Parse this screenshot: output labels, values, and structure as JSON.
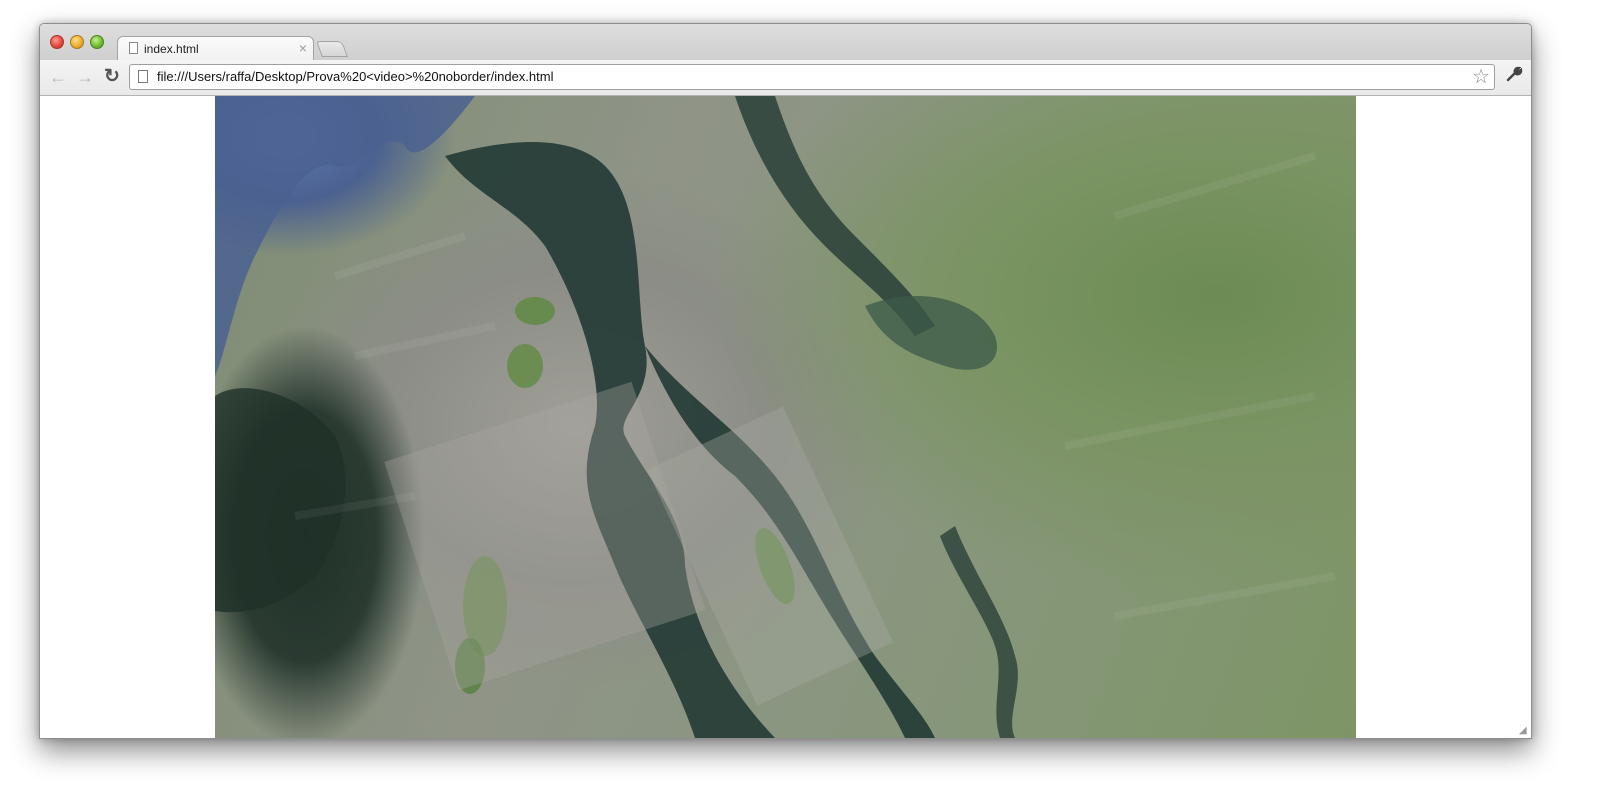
{
  "window": {
    "traffic_lights": [
      "close",
      "minimize",
      "maximize"
    ]
  },
  "tab": {
    "title": "index.html",
    "close_icon": "×"
  },
  "toolbar": {
    "back_icon": "←",
    "forward_icon": "→",
    "reload_icon": "↻",
    "url": "file:///Users/raffa/Desktop/Prova%20<video>%20noborder/index.html",
    "bookmark_icon": "☆",
    "wrench_icon": "🔧"
  },
  "content": {
    "video_subject": "aerial-satellite-view"
  },
  "colors": {
    "water_dark": "#223a34",
    "water_blue": "#4b6190",
    "land_urban": "#8e8f88",
    "land_green": "#6f8f55"
  }
}
